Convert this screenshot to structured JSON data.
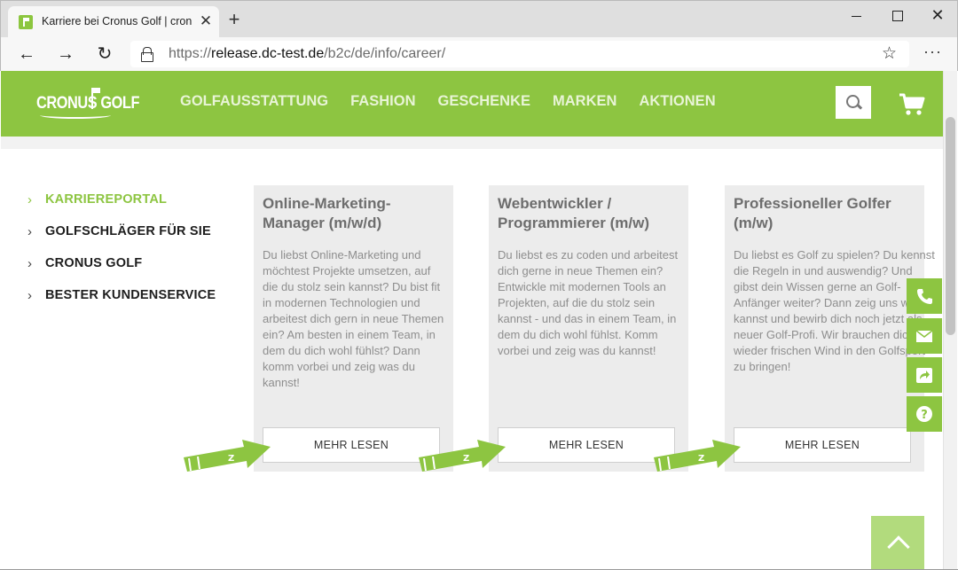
{
  "browser": {
    "tab_title": "Karriere bei Cronus Golf | cronus",
    "tab_close": "✕",
    "new_tab": "+",
    "window_close": "✕",
    "url_scheme": "https://",
    "url_host": "release.dc-test.de",
    "url_path": "/b2c/de/info/career/",
    "back": "←",
    "forward": "→",
    "reload": "↻",
    "star": "☆",
    "more": "···"
  },
  "header": {
    "logo_text": "CRONUS GOLF",
    "nav": [
      "GOLFAUSSTATTUNG",
      "FASHION",
      "GESCHENKE",
      "MARKEN",
      "AKTIONEN"
    ]
  },
  "sidebar": {
    "items": [
      {
        "label": "KARRIEREPORTAL",
        "active": true
      },
      {
        "label": "GOLFSCHLÄGER FÜR SIE",
        "active": false
      },
      {
        "label": "CRONUS GOLF",
        "active": false
      },
      {
        "label": "BESTER KUNDENSERVICE",
        "active": false
      }
    ],
    "chevron": "›"
  },
  "cards": [
    {
      "title": "Online-Marketing-Manager (m/w/d)",
      "text": "Du liebst Online-Marketing und möchtest Projekte umsetzen, auf die du stolz sein kannst? Du bist fit in modernen Technologien und arbeitest dich gern in neue Themen ein? Am besten in einem Team, in dem du dich wohl fühlst? Dann komm vorbei und zeig was du kannst!",
      "button": "MEHR LESEN"
    },
    {
      "title": "Webentwickler / Programmierer (m/w)",
      "text": "Du liebst es zu coden und arbeitest dich gerne in neue Themen ein? Entwickle mit modernen Tools an Projekten, auf die du stolz sein kannst - und das in einem Team, in dem du dich wohl fühlst. Komm vorbei und zeig was du kannst!",
      "button": "MEHR LESEN"
    },
    {
      "title": "Professioneller Golfer (m/w)",
      "text": "Du liebst es Golf zu spielen? Du kennst die Regeln in und auswendig? Und gibst dein Wissen gerne an Golf-Anfänger weiter? Dann zeig uns was du kannst und bewirb dich noch jetzt als neuer Golf-Profi. Wir brauchen dich, um wieder frischen Wind in den Golfsport zu bringen!",
      "button": "MEHR LESEN"
    }
  ],
  "colors": {
    "brand_green": "#8dc541",
    "light_green": "#b2db7d",
    "card_bg": "#ececec"
  },
  "icons": {
    "float": [
      "phone-icon",
      "mail-icon",
      "share-icon",
      "help-icon"
    ],
    "header": [
      "search-icon",
      "cart-icon"
    ],
    "arrows": "pencil-arrow-icon"
  }
}
